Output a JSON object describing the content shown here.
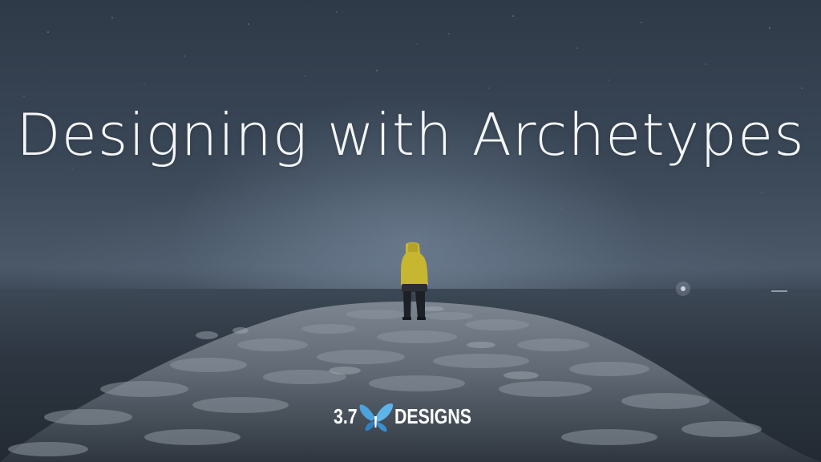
{
  "slide": {
    "title": "Designing with Archetypes"
  },
  "logo": {
    "number": "3.7",
    "word": "DESIGNS",
    "icon": "butterfly-icon",
    "colors": {
      "text": "#ffffff",
      "wing": "#4aa3dd",
      "wing_dark": "#2f7fc1"
    }
  },
  "scene": {
    "colors": {
      "sky": "#3a4757",
      "jacket": "#c7b630",
      "rocks": "#6d7682"
    }
  }
}
